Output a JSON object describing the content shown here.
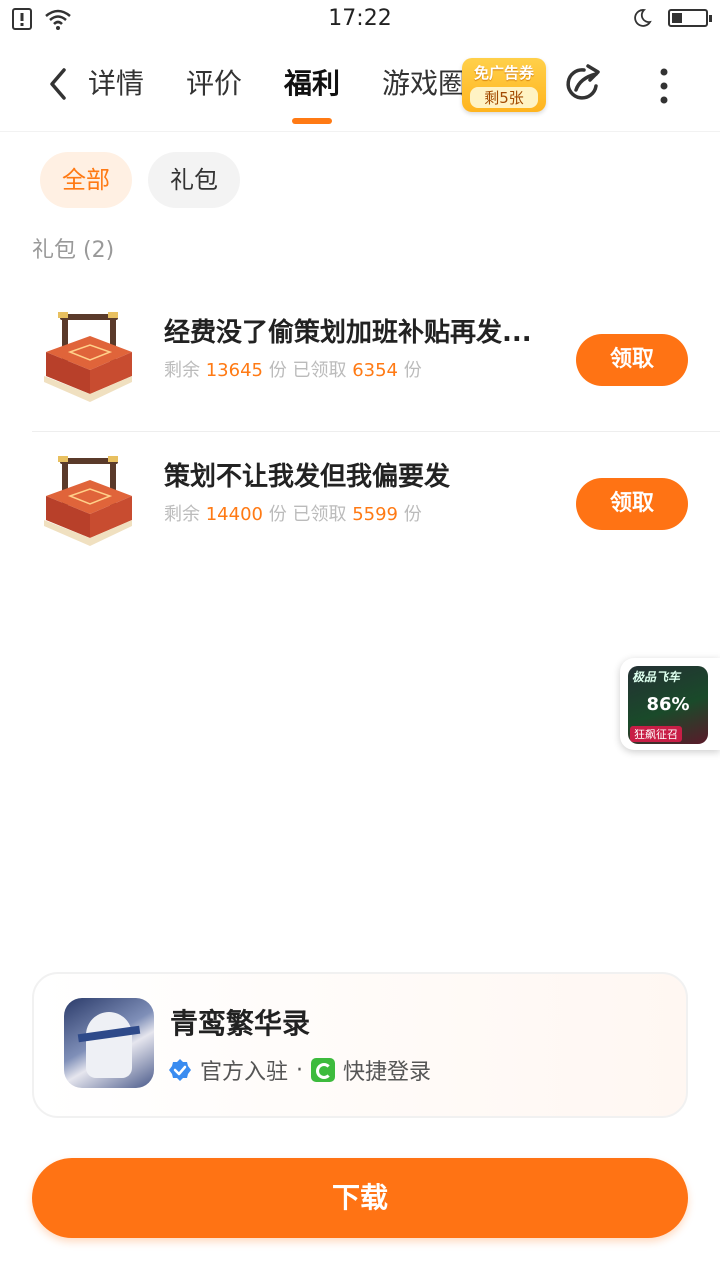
{
  "status_bar": {
    "time": "17:22",
    "icons": [
      "sim-alert-icon",
      "wifi-icon",
      "moon-icon",
      "battery-icon"
    ],
    "battery_level": 0.3
  },
  "nav": {
    "back_icon": "chevron-left-icon",
    "tabs": [
      {
        "label": "详情",
        "active": false
      },
      {
        "label": "评价",
        "active": false
      },
      {
        "label": "福利",
        "active": true
      },
      {
        "label": "游戏圈",
        "active": false
      }
    ],
    "ad_badge": {
      "line1": "免广告券",
      "line2": "剩5张"
    },
    "share_icon": "share-icon",
    "more_icon": "more-vertical-icon"
  },
  "filters": {
    "chips": [
      {
        "label": "全部",
        "active": true
      },
      {
        "label": "礼包",
        "active": false
      }
    ]
  },
  "section": {
    "title": "礼包 (2)"
  },
  "gifts": [
    {
      "title": "经费没了偷策划加班补贴再发...",
      "remaining_label": "剩余",
      "remaining": "13645",
      "unit": "份",
      "claimed_label": "已领取",
      "claimed": "6354",
      "button": "领取",
      "icon": "gift-box-icon"
    },
    {
      "title": "策划不让我发但我偏要发",
      "remaining_label": "剩余",
      "remaining": "14400",
      "unit": "份",
      "claimed_label": "已领取",
      "claimed": "5599",
      "button": "领取",
      "icon": "gift-box-icon"
    }
  ],
  "float_widget": {
    "title": "极品飞车",
    "progress": "86%",
    "subtitle": "狂飙征召"
  },
  "app_card": {
    "name": "青鸾繁华录",
    "tag_verified": "官方入驻",
    "separator": "·",
    "tag_quick": "快捷登录"
  },
  "download": {
    "label": "下载"
  },
  "colors": {
    "accent": "#ff7314",
    "accent_light": "#fff0e3",
    "muted": "#bbbbbb"
  }
}
